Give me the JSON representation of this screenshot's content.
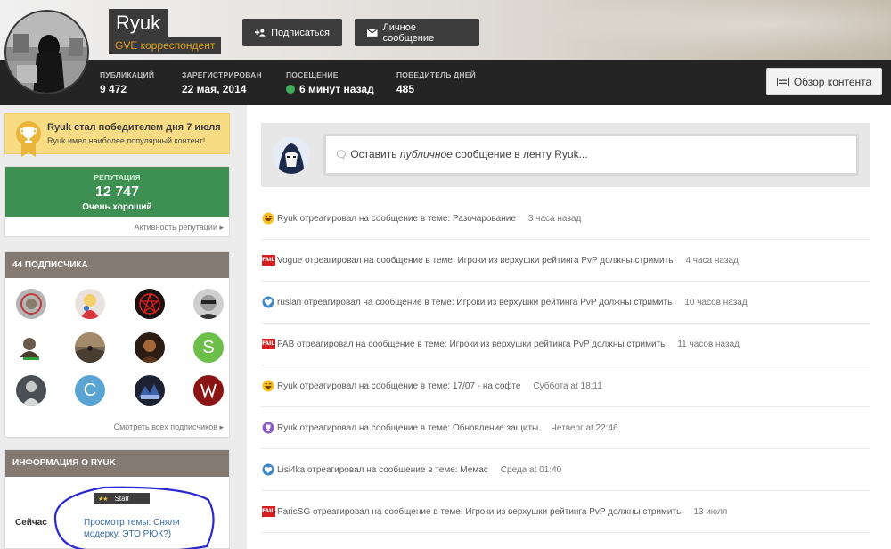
{
  "profile": {
    "name": "Ryuk",
    "rank": "GVE корреспондент",
    "follow_label": "Подписаться",
    "message_label": "Личное сообщение",
    "overview_label": "Обзор контента",
    "stats": [
      {
        "key": "ПУБЛИКАЦИЙ",
        "value": "9 472"
      },
      {
        "key": "ЗАРЕГИСТРИРОВАН",
        "value": "22 мая, 2014"
      },
      {
        "key": "ПОСЕЩЕНИЕ",
        "value": "6 минут назад",
        "status_color": "#3fae5b"
      },
      {
        "key": "ПОБЕДИТЕЛЬ ДНЕЙ",
        "value": "485"
      }
    ]
  },
  "winner": {
    "title": "Ryuk стал победителем дня 7 июля",
    "subtitle": "Ryuk имел наиболее популярный контент!",
    "icon": "trophy-icon"
  },
  "reputation": {
    "label": "РЕПУТАЦИЯ",
    "value": "12 747",
    "description": "Очень хороший",
    "link": "Активность репутации ▸",
    "color": "#3e8f52"
  },
  "followers": {
    "title": "44 ПОДПИСЧИКА",
    "see_all": "Смотреть всех подписчиков ▸",
    "avatars": [
      {
        "letter": "",
        "bg": "#b5b5b5"
      },
      {
        "letter": "",
        "bg": "#e9e2de"
      },
      {
        "letter": "",
        "bg": "#1a1010"
      },
      {
        "letter": "",
        "bg": "#cfcfcf"
      },
      {
        "letter": "",
        "bg": "#ffffff"
      },
      {
        "letter": "",
        "bg": "#7a6a5a"
      },
      {
        "letter": "",
        "bg": "#2b1d14"
      },
      {
        "letter": "S",
        "bg": "#6cc04a"
      },
      {
        "letter": "",
        "bg": "#4a4e55"
      },
      {
        "letter": "C",
        "bg": "#5aa4d4"
      },
      {
        "letter": "",
        "bg": "#1d2233"
      },
      {
        "letter": "",
        "bg": "#8a1414"
      }
    ]
  },
  "info": {
    "title": "ИНФОРМАЦИЯ О RYUK",
    "now_label": "Сейчас",
    "badge_stars": "★★",
    "badge_label": "Staff",
    "activity": "Просмотр темы: Сняли модерку. ЭТО РЮК?)"
  },
  "compose": {
    "icon": "comment-icon",
    "prefix": "Оставить ",
    "italic": "публичное",
    "suffix": " сообщение в ленту Ryuk..."
  },
  "feed": [
    {
      "icon": "laugh",
      "text": "Ryuk отреагировал на сообщение в теме: Разочарование",
      "time": "3 часа назад"
    },
    {
      "icon": "fail",
      "text": "Vogue отреагировал на сообщение в теме: Игроки из верхушки рейтинга PvP должны стримить",
      "time": "4 часа назад"
    },
    {
      "icon": "like",
      "text": "ruslan отреагировал на сообщение в теме: Игроки из верхушки рейтинга PvP должны стримить",
      "time": "10 часов назад"
    },
    {
      "icon": "fail",
      "text": "PAB отреагировал на сообщение в теме: Игроки из верхушки рейтинга PvP должны стримить",
      "time": "11 часов назад"
    },
    {
      "icon": "laugh",
      "text": "Ryuk отреагировал на сообщение в теме: 17/07 - на софте",
      "time": "Суббота at 18:11"
    },
    {
      "icon": "trophy",
      "text": "Ryuk отреагировал на сообщение в теме: Обновление защиты",
      "time": "Четверг at 22:46"
    },
    {
      "icon": "like",
      "text": "Lisi4ka отреагировал на сообщение в теме: Мемас",
      "time": "Среда at 01:40"
    },
    {
      "icon": "fail",
      "text": "ParisSG отреагировал на сообщение в теме: Игроки из верхушки рейтинга PvP должны стримить",
      "time": "13 июля"
    }
  ],
  "fail_label": "FAIL"
}
